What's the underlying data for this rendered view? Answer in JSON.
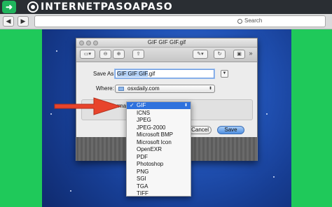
{
  "site": {
    "badge_icon": "arrow-icon",
    "logo_text": "INTERNETPASOAPASO"
  },
  "browser": {
    "back_icon": "back-icon",
    "forward_icon": "forward-icon",
    "search_placeholder": "Search"
  },
  "dialog": {
    "title": "GIF GIF GIF.gif",
    "save_as_label": "Save As:",
    "filename_prefix": "GIF GIF GIF",
    "filename_ext": ".gif",
    "where_label": "Where:",
    "where_value": "osxdaily.com",
    "format_label": "Format",
    "cancel_label": "Cancel",
    "save_label": "Save"
  },
  "format_menu": {
    "selected": "GIF",
    "items": [
      "GIF",
      "ICNS",
      "JPEG",
      "JPEG-2000",
      "Microsoft BMP",
      "Microsoft Icon",
      "OpenEXR",
      "PDF",
      "Photoshop",
      "PNG",
      "SGI",
      "TGA",
      "TIFF"
    ]
  },
  "annotation": {
    "arrow_color": "#e8442c"
  }
}
